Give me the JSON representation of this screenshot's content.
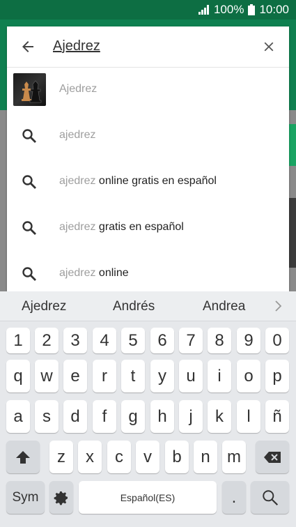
{
  "status": {
    "battery": "100%",
    "time": "10:00"
  },
  "search": {
    "query": "Ajedrez"
  },
  "suggestions": [
    {
      "label": "Ajedrez",
      "rest": ""
    },
    {
      "label": "ajedrez",
      "rest": ""
    },
    {
      "label": "ajedrez",
      "rest": " online gratis en español"
    },
    {
      "label": "ajedrez",
      "rest": " gratis en español"
    },
    {
      "label": "ajedrez",
      "rest": " online"
    }
  ],
  "keyboard": {
    "suggestions": [
      "Ajedrez",
      "Andrés",
      "Andrea"
    ],
    "numbers": [
      "1",
      "2",
      "3",
      "4",
      "5",
      "6",
      "7",
      "8",
      "9",
      "0"
    ],
    "row1": [
      "q",
      "w",
      "e",
      "r",
      "t",
      "y",
      "u",
      "i",
      "o",
      "p"
    ],
    "row2": [
      "a",
      "s",
      "d",
      "f",
      "g",
      "h",
      "j",
      "k",
      "l",
      "ñ"
    ],
    "row3": [
      "z",
      "x",
      "c",
      "v",
      "b",
      "n",
      "m"
    ],
    "sym": "Sym",
    "space": "Español(ES)",
    "period": "."
  },
  "colors": {
    "status_bar": "#0d6e43",
    "app_bar": "#0f8050"
  }
}
